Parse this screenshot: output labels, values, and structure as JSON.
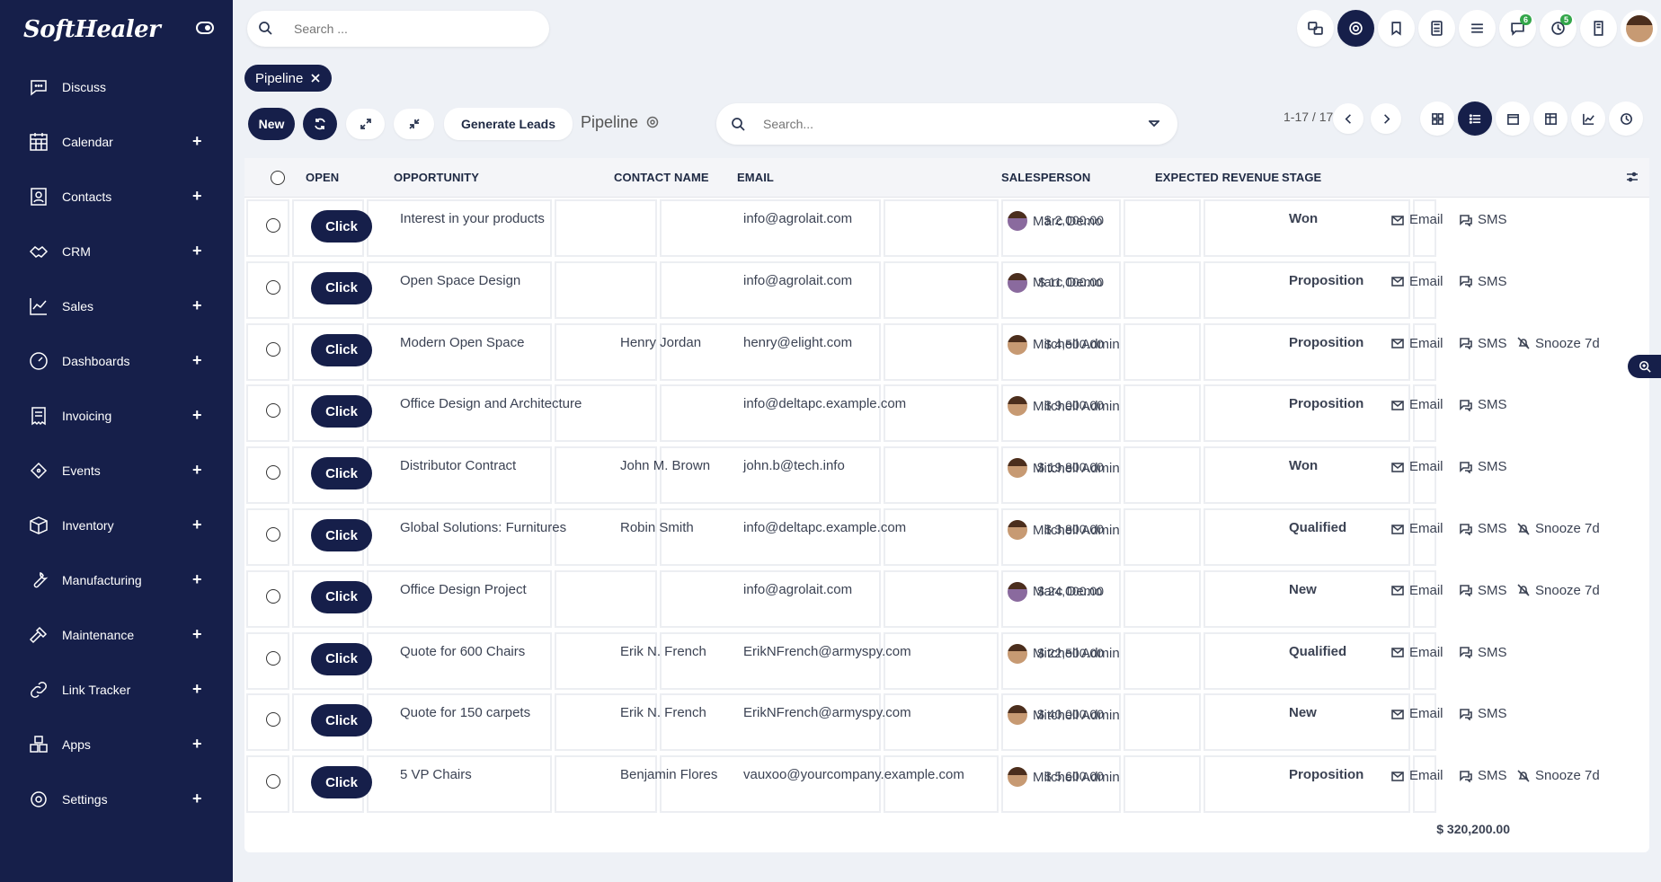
{
  "brand": "SoftHealer",
  "sidebar": {
    "items": [
      {
        "label": "Discuss",
        "icon": "chat-bubble-icon",
        "plus": ""
      },
      {
        "label": "Calendar",
        "icon": "calendar-icon",
        "plus": "+"
      },
      {
        "label": "Contacts",
        "icon": "contact-card-icon",
        "plus": "+"
      },
      {
        "label": "CRM",
        "icon": "handshake-icon",
        "plus": "+"
      },
      {
        "label": "Sales",
        "icon": "line-chart-icon",
        "plus": "+"
      },
      {
        "label": "Dashboards",
        "icon": "gauge-icon",
        "plus": "+"
      },
      {
        "label": "Invoicing",
        "icon": "receipt-icon",
        "plus": "+"
      },
      {
        "label": "Events",
        "icon": "ticket-icon",
        "plus": "+"
      },
      {
        "label": "Inventory",
        "icon": "box-icon",
        "plus": "+"
      },
      {
        "label": "Manufacturing",
        "icon": "wrench-icon",
        "plus": "+"
      },
      {
        "label": "Maintenance",
        "icon": "hammer-icon",
        "plus": "+"
      },
      {
        "label": "Link Tracker",
        "icon": "link-icon",
        "plus": "+"
      },
      {
        "label": "Apps",
        "icon": "cubes-icon",
        "plus": "+"
      },
      {
        "label": "Settings",
        "icon": "gear-icon",
        "plus": "+"
      }
    ]
  },
  "topbar": {
    "search_placeholder": "Search ...",
    "badges": {
      "messages": "6",
      "activities": "5"
    }
  },
  "breadcrumb": {
    "label": "Pipeline"
  },
  "controls": {
    "new_label": "New",
    "generate_leads_label": "Generate Leads",
    "pipeline_title": "Pipeline",
    "search_placeholder": "Search...",
    "pager": "1-17 / 17"
  },
  "table": {
    "headers": {
      "open": "OPEN",
      "opportunity": "OPPORTUNITY",
      "contact": "CONTACT NAME",
      "email": "EMAIL",
      "salesperson": "SALESPERSON",
      "revenue": "EXPECTED REVENUE",
      "stage": "STAGE"
    },
    "click_label": "Click",
    "action_email": "Email",
    "action_sms": "SMS",
    "action_snooze": "Snooze 7d",
    "rows": [
      {
        "opportunity": "Interest in your products",
        "contact": "",
        "email": "info@agrolait.com",
        "salesperson": "Marc Demo",
        "revenue": "$ 2,000.00",
        "stage": "Won",
        "snooze": false
      },
      {
        "opportunity": "Open Space Design",
        "contact": "",
        "email": "info@agrolait.com",
        "salesperson": "Marc Demo",
        "revenue": "$ 11,000.00",
        "stage": "Proposition",
        "snooze": false
      },
      {
        "opportunity": "Modern Open Space",
        "contact": "Henry Jordan",
        "email": "henry@elight.com",
        "salesperson": "Mitchell Admin",
        "revenue": "$ 4,500.00",
        "stage": "Proposition",
        "snooze": true
      },
      {
        "opportunity": "Office Design and Architecture",
        "contact": "",
        "email": "info@deltapc.example.com",
        "salesperson": "Mitchell Admin",
        "revenue": "$ 9,000.00",
        "stage": "Proposition",
        "snooze": false
      },
      {
        "opportunity": "Distributor Contract",
        "contact": "John M. Brown",
        "email": "john.b@tech.info",
        "salesperson": "Mitchell Admin",
        "revenue": "$ 19,800.00",
        "stage": "Won",
        "snooze": false
      },
      {
        "opportunity": "Global Solutions: Furnitures",
        "contact": "Robin Smith",
        "email": "info@deltapc.example.com",
        "salesperson": "Mitchell Admin",
        "revenue": "$ 3,800.00",
        "stage": "Qualified",
        "snooze": true
      },
      {
        "opportunity": "Office Design Project",
        "contact": "",
        "email": "info@agrolait.com",
        "salesperson": "Marc Demo",
        "revenue": "$ 24,000.00",
        "stage": "New",
        "snooze": true
      },
      {
        "opportunity": "Quote for 600 Chairs",
        "contact": "Erik N. French",
        "email": "ErikNFrench@armyspy.com",
        "salesperson": "Mitchell Admin",
        "revenue": "$ 22,500.00",
        "stage": "Qualified",
        "snooze": false
      },
      {
        "opportunity": "Quote for 150 carpets",
        "contact": "Erik N. French",
        "email": "ErikNFrench@armyspy.com",
        "salesperson": "Mitchell Admin",
        "revenue": "$ 40,000.00",
        "stage": "New",
        "snooze": false
      },
      {
        "opportunity": "5 VP Chairs",
        "contact": "Benjamin Flores",
        "email": "vauxoo@yourcompany.example.com",
        "salesperson": "Mitchell Admin",
        "revenue": "$ 5,600.00",
        "stage": "Proposition",
        "snooze": true
      }
    ],
    "total": "$ 320,200.00"
  },
  "colors": {
    "sidebar": "#161f4a",
    "accent": "#161f4a",
    "badge": "#33a64a",
    "background": "#eef1f6"
  }
}
